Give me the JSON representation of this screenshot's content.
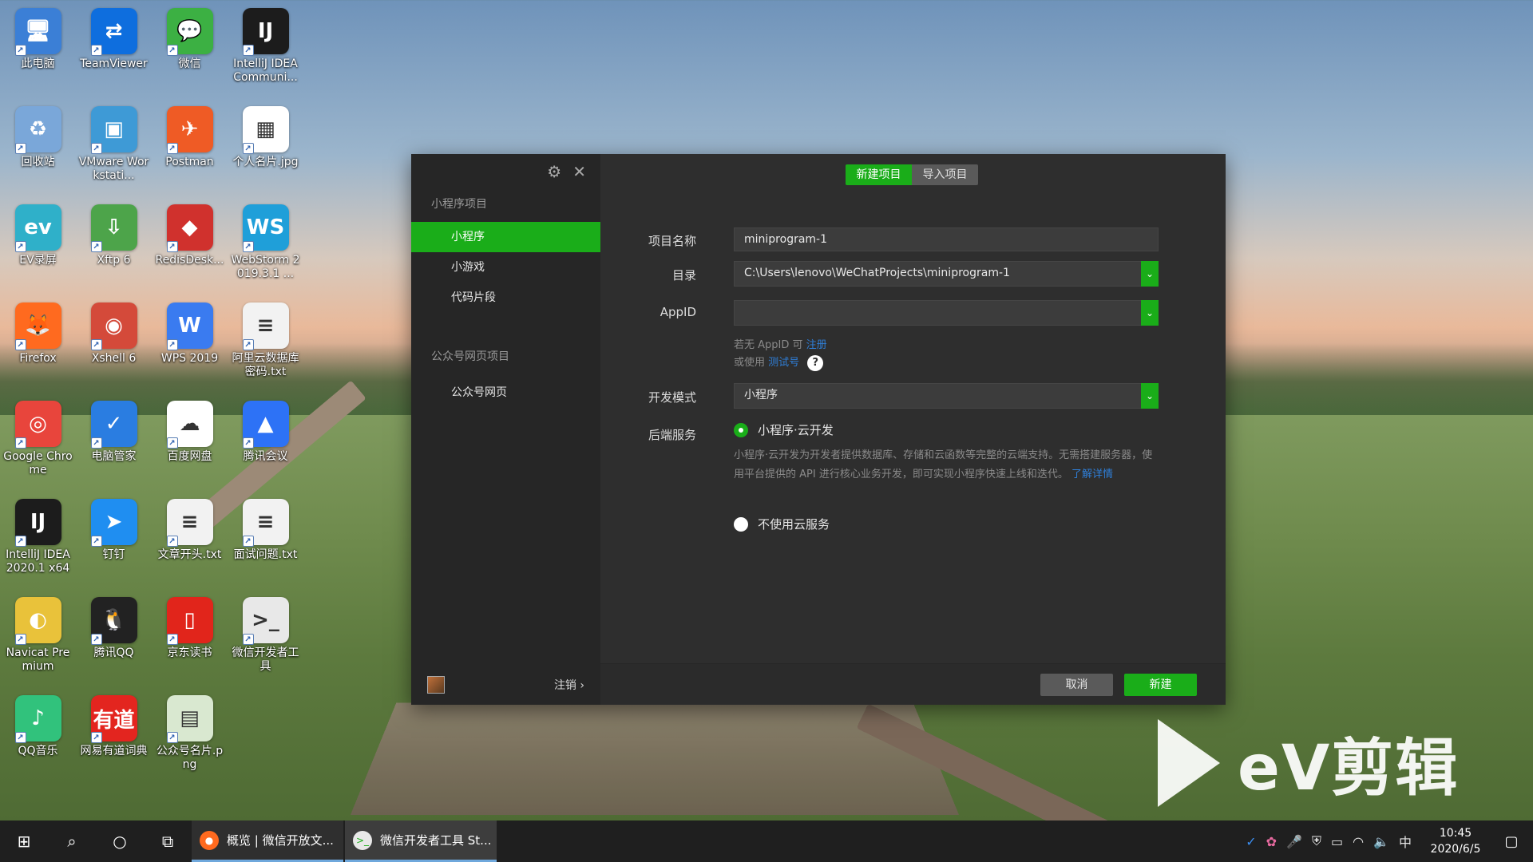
{
  "desktop": {
    "icons": [
      {
        "label": "此电脑",
        "icon": "computer-icon",
        "color": "#3b7fd6",
        "glyph": "🖥"
      },
      {
        "label": "TeamViewer",
        "icon": "teamviewer-icon",
        "color": "#0e6ede",
        "glyph": "⇄"
      },
      {
        "label": "微信",
        "icon": "wechat-icon",
        "color": "#3cb043",
        "glyph": "💬"
      },
      {
        "label": "IntelliJ IDEA Communi...",
        "icon": "intellij-icon",
        "color": "#1c1c1c",
        "glyph": "IJ"
      },
      {
        "label": "回收站",
        "icon": "recycle-bin-icon",
        "color": "#7aa7d9",
        "glyph": "♻"
      },
      {
        "label": "VMware Workstati...",
        "icon": "vmware-icon",
        "color": "#3e9ad6",
        "glyph": "▣"
      },
      {
        "label": "Postman",
        "icon": "postman-icon",
        "color": "#ef5b25",
        "glyph": "✈"
      },
      {
        "label": "个人名片.jpg",
        "icon": "qr-code-image-icon",
        "color": "#ffffff",
        "glyph": "▦"
      },
      {
        "label": "EV录屏",
        "icon": "ev-recorder-icon",
        "color": "#2fb0c9",
        "glyph": "ev"
      },
      {
        "label": "Xftp 6",
        "icon": "xftp-icon",
        "color": "#4da44a",
        "glyph": "⇩"
      },
      {
        "label": "RedisDesk...",
        "icon": "redis-icon",
        "color": "#d0312d",
        "glyph": "◆"
      },
      {
        "label": "WebStorm 2019.3.1 ...",
        "icon": "webstorm-icon",
        "color": "#1f9fd9",
        "glyph": "WS"
      },
      {
        "label": "Firefox",
        "icon": "firefox-icon",
        "color": "#ff6a1f",
        "glyph": "🦊"
      },
      {
        "label": "Xshell 6",
        "icon": "xshell-icon",
        "color": "#d44a3a",
        "glyph": "◉"
      },
      {
        "label": "WPS 2019",
        "icon": "wps-icon",
        "color": "#3a7bf0",
        "glyph": "W"
      },
      {
        "label": "阿里云数据库密码.txt",
        "icon": "text-file-icon",
        "color": "#f2f2f2",
        "glyph": "≡"
      },
      {
        "label": "Google Chrome",
        "icon": "chrome-icon",
        "color": "#e8453c",
        "glyph": "◎"
      },
      {
        "label": "电脑管家",
        "icon": "pc-manager-icon",
        "color": "#2a7de1",
        "glyph": "✓"
      },
      {
        "label": "百度网盘",
        "icon": "baidu-netdisk-icon",
        "color": "#ffffff",
        "glyph": "☁"
      },
      {
        "label": "腾讯会议",
        "icon": "tencent-meeting-icon",
        "color": "#2d72f6",
        "glyph": "▲"
      },
      {
        "label": "IntelliJ IDEA 2020.1 x64",
        "icon": "intellij-icon",
        "color": "#1c1c1c",
        "glyph": "IJ"
      },
      {
        "label": "钉钉",
        "icon": "dingtalk-icon",
        "color": "#1f8ef1",
        "glyph": "➤"
      },
      {
        "label": "文章开头.txt",
        "icon": "text-file-icon",
        "color": "#f2f2f2",
        "glyph": "≡"
      },
      {
        "label": "面试问题.txt",
        "icon": "text-file-icon",
        "color": "#f2f2f2",
        "glyph": "≡"
      },
      {
        "label": "Navicat Premium",
        "icon": "navicat-icon",
        "color": "#e9c23a",
        "glyph": "◐"
      },
      {
        "label": "腾讯QQ",
        "icon": "qq-icon",
        "color": "#222222",
        "glyph": "🐧"
      },
      {
        "label": "京东读书",
        "icon": "jd-reading-icon",
        "color": "#e1251b",
        "glyph": "▯"
      },
      {
        "label": "微信开发者工具",
        "icon": "wechat-devtools-icon",
        "color": "#e8e8e8",
        "glyph": ">_"
      },
      {
        "label": "QQ音乐",
        "icon": "qq-music-icon",
        "color": "#31c27c",
        "glyph": "♪"
      },
      {
        "label": "网易有道词典",
        "icon": "youdao-icon",
        "color": "#e3251f",
        "glyph": "有道"
      },
      {
        "label": "公众号名片.png",
        "icon": "image-file-icon",
        "color": "#d9e8d0",
        "glyph": "▤"
      }
    ]
  },
  "dialog": {
    "sidebar": {
      "group1": "小程序项目",
      "items1": [
        "小程序",
        "小游戏",
        "代码片段"
      ],
      "group2": "公众号网页项目",
      "items2": [
        "公众号网页"
      ],
      "logout": "注销",
      "logout_chevron": "›"
    },
    "tabs": {
      "new": "新建项目",
      "import": "导入项目"
    },
    "form": {
      "name_label": "项目名称",
      "name_value": "miniprogram-1",
      "dir_label": "目录",
      "dir_value": "C:\\Users\\lenovo\\WeChatProjects\\miniprogram-1",
      "appid_label": "AppID",
      "appid_value": "",
      "hint1_prefix": "若无 AppID 可",
      "hint1_link": "注册",
      "hint2_prefix": "或使用",
      "hint2_link": "测试号",
      "help": "?",
      "mode_label": "开发模式",
      "mode_value": "小程序",
      "backend_label": "后端服务",
      "option_cloud": "小程序·云开发",
      "cloud_desc": "小程序·云开发为开发者提供数据库、存储和云函数等完整的云端支持。无需搭建服务器，使用平台提供的 API 进行核心业务开发，即可实现小程序快速上线和迭代。",
      "cloud_link": "了解详情",
      "option_none": "不使用云服务"
    },
    "buttons": {
      "cancel": "取消",
      "create": "新建"
    }
  },
  "watermark": {
    "text": "eV剪辑"
  },
  "taskbar": {
    "apps": [
      {
        "label": "概览 | 微信开放文...",
        "icon": "firefox-icon"
      },
      {
        "label": "微信开发者工具 St...",
        "icon": "wechat-devtools-icon"
      }
    ],
    "ime": "中",
    "time": "10:45",
    "date": "2020/6/5"
  },
  "colors": {
    "accent": "#1aad19",
    "link": "#2f7fd8",
    "dialog_bg": "#2e2e2e",
    "sidebar_bg": "#262626"
  }
}
